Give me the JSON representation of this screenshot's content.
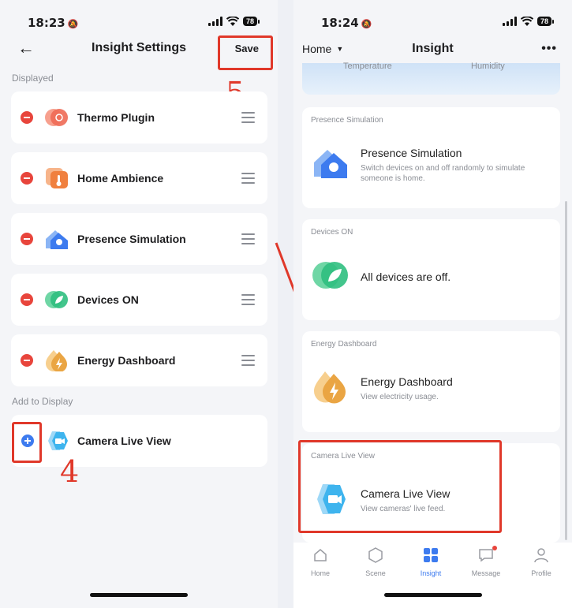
{
  "left": {
    "status": {
      "time": "18:23",
      "battery": "78"
    },
    "nav": {
      "back_icon": "arrow-left-icon",
      "title": "Insight Settings",
      "save_label": "Save"
    },
    "displayed_label": "Displayed",
    "displayed_items": [
      {
        "label": "Thermo Plugin",
        "icon": "thermo-plugin-icon"
      },
      {
        "label": "Home Ambience",
        "icon": "home-ambience-icon"
      },
      {
        "label": "Presence Simulation",
        "icon": "presence-simulation-icon"
      },
      {
        "label": "Devices ON",
        "icon": "devices-on-icon"
      },
      {
        "label": "Energy Dashboard",
        "icon": "energy-dashboard-icon"
      }
    ],
    "add_label": "Add to Display",
    "available_items": [
      {
        "label": "Camera Live View",
        "icon": "camera-live-view-icon"
      }
    ],
    "annotations": {
      "step4": "4",
      "step5": "5"
    }
  },
  "right": {
    "status": {
      "time": "18:24",
      "battery": "78"
    },
    "nav": {
      "home_label": "Home",
      "title": "Insight",
      "more_icon": "more-dots-icon"
    },
    "weather_partial": {
      "left": "Temperature",
      "right": "Humidity"
    },
    "cards": [
      {
        "section": "Presence Simulation",
        "name": "Presence Simulation",
        "desc": "Switch devices on and off randomly to simulate someone is home."
      },
      {
        "section": "Devices ON",
        "name": "All devices are off.",
        "desc": ""
      },
      {
        "section": "Energy Dashboard",
        "name": "Energy Dashboard",
        "desc": "View electricity usage."
      },
      {
        "section": "Camera Live View",
        "name": "Camera Live View",
        "desc": "View cameras' live feed."
      }
    ],
    "tabs": [
      {
        "label": "Home",
        "icon": "home-icon"
      },
      {
        "label": "Scene",
        "icon": "scene-icon"
      },
      {
        "label": "Insight",
        "icon": "insight-icon",
        "active": true
      },
      {
        "label": "Message",
        "icon": "message-icon",
        "badge": true
      },
      {
        "label": "Profile",
        "icon": "profile-icon"
      }
    ]
  },
  "colors": {
    "accent": "#3d7bef",
    "annotation": "#e0382a",
    "remove": "#e8453c"
  }
}
